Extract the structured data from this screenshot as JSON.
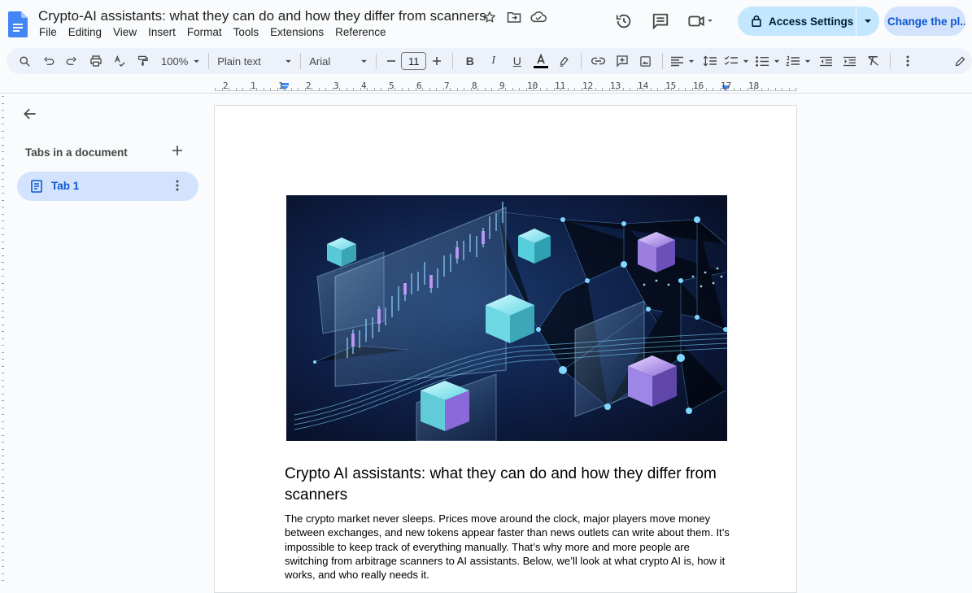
{
  "app": {
    "document_title": "Crypto-AI assistants: what they can do and how they differ from scanners",
    "menu": [
      "File",
      "Editing",
      "View",
      "Insert",
      "Format",
      "Tools",
      "Extensions",
      "Reference"
    ]
  },
  "header": {
    "access_button_label": "Access Settings",
    "change_button_label": "Change the pl..."
  },
  "toolbar": {
    "zoom": "100%",
    "style": "Plain text",
    "font": "Arial",
    "font_size": "11"
  },
  "ruler": {
    "ticks": [
      "2",
      "1",
      "1",
      "2",
      "3",
      "4",
      "5",
      "6",
      "7",
      "8",
      "9",
      "10",
      "11",
      "12",
      "13",
      "14",
      "15",
      "16",
      "17",
      "18"
    ]
  },
  "sidebar": {
    "section_label": "Tabs in a document",
    "tabs": [
      {
        "label": "Tab 1"
      }
    ]
  },
  "document": {
    "heading": "Crypto AI assistants: what they can do and how they differ from scanners",
    "paragraph": "The crypto market never sleeps. Prices move around the clock, major players move money between exchanges, and new tokens appear faster than news outlets can write about them. It’s impossible to keep track of everything manually. That’s why more and more people are switching from arbitrage scanners to AI assistants. Below, we’ll look at what crypto AI is, how it works, and who really needs it."
  },
  "colors": {
    "accent": "#0b57d0",
    "access_button_bg": "#c2e7ff",
    "selected_tab_bg": "#d3e3fd",
    "toolbar_bg": "#edf2fa"
  }
}
